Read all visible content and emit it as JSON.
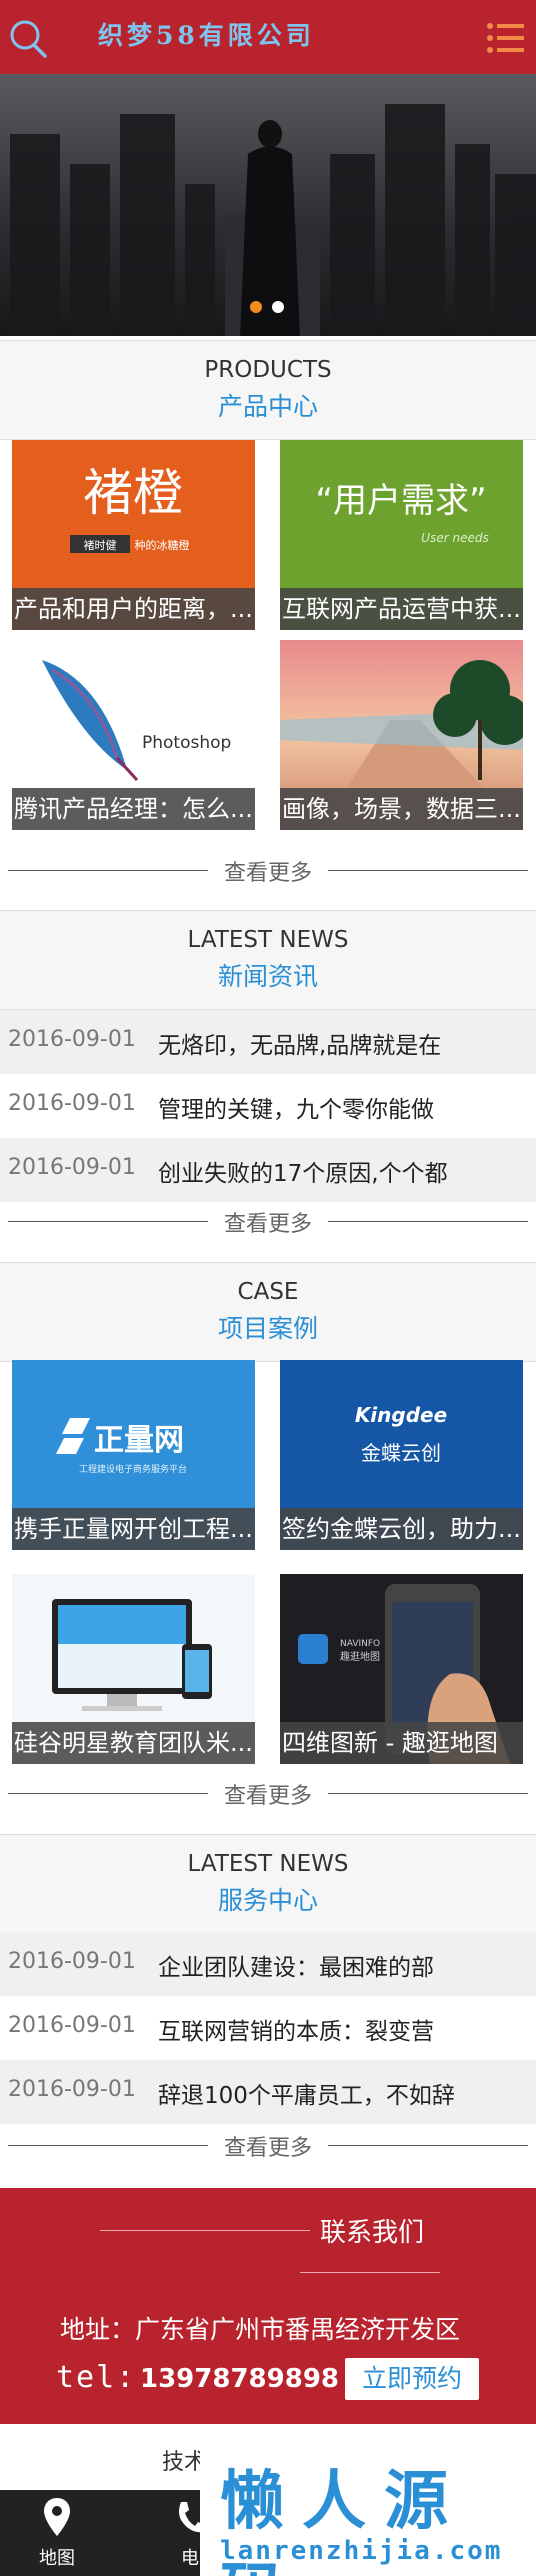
{
  "header": {
    "logo_text": "织梦58有限公司",
    "brand_color": "#b8232d",
    "accent_color": "#2b8fd6"
  },
  "banner": {
    "active_slide": 1,
    "slide_count": 2
  },
  "products": {
    "en": "PRODUCTS",
    "cn": "产品中心",
    "items": [
      {
        "caption": "产品和用户的距离，...",
        "image_text": "褚橙",
        "image_sub_a": "褚时健",
        "image_sub_b": "种的冰糖橙"
      },
      {
        "caption": "互联网产品运营中获...",
        "image_text": "“用户需求”",
        "image_sub_a": "User needs"
      },
      {
        "caption": "腾讯产品经理：怎么...",
        "image_text": "Photoshop"
      },
      {
        "caption": "画像，场景，数据三..."
      }
    ],
    "more": "查看更多"
  },
  "news": {
    "en": "LATEST NEWS",
    "cn": "新闻资讯",
    "items": [
      {
        "date": "2016-09-01",
        "title": "无烙印，无品牌,品牌就是在"
      },
      {
        "date": "2016-09-01",
        "title": "管理的关键，九个零你能做"
      },
      {
        "date": "2016-09-01",
        "title": "创业失败的17个原因,个个都"
      }
    ],
    "more": "查看更多"
  },
  "cases": {
    "en": "CASE",
    "cn": "项目案例",
    "items": [
      {
        "caption": "携手正量网开创工程...",
        "image_text": "正量网",
        "image_sub": "工程建设电子商务服务平台"
      },
      {
        "caption": "签约金蝶云创，助力...",
        "image_text": "Kingdee",
        "image_sub": "金蝶云创"
      },
      {
        "caption": "硅谷明星教育团队米..."
      },
      {
        "caption": "四维图新 - 趣逛地图",
        "image_sub": "趣逛地图"
      }
    ],
    "more": "查看更多"
  },
  "service": {
    "en": "LATEST NEWS",
    "cn": "服务中心",
    "items": [
      {
        "date": "2016-09-01",
        "title": "企业团队建设：最困难的部"
      },
      {
        "date": "2016-09-01",
        "title": "互联网营销的本质：裂变营"
      },
      {
        "date": "2016-09-01",
        "title": "辞退100个平庸员工，不如辞"
      }
    ],
    "more": "查看更多"
  },
  "contact": {
    "title": "联系我们",
    "address": "地址：广东省广州市番禺经济开发区",
    "tel_label": "tel:",
    "tel": "13978789898",
    "button": "立即预约"
  },
  "footer": {
    "tech": "技术",
    "nav": [
      {
        "label": "地图",
        "icon": "map-pin-icon"
      },
      {
        "label": "电",
        "icon": "phone-icon"
      }
    ],
    "watermark_big": "懒人源码",
    "watermark_small": "lanrenzhijia.com"
  }
}
